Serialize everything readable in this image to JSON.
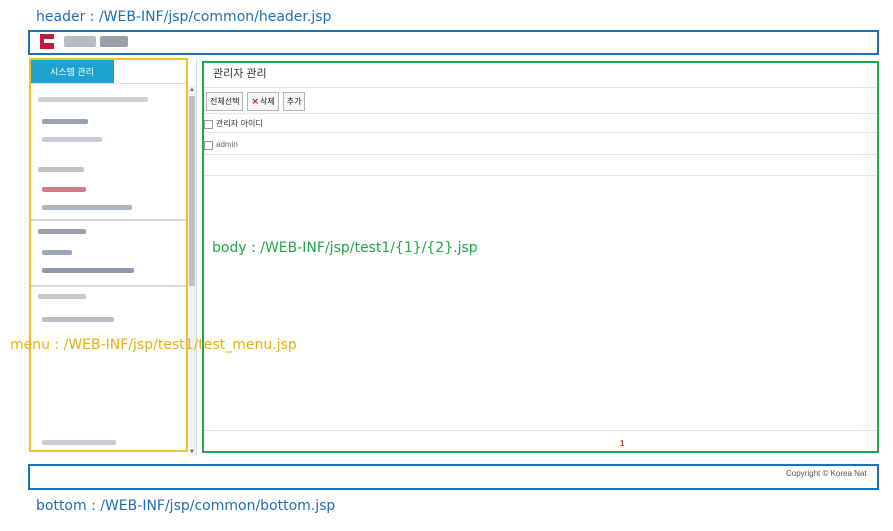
{
  "annotations": {
    "header": "header : /WEB-INF/jsp/common/header.jsp",
    "body": "body : /WEB-INF/jsp/test1/{1}/{2}.jsp",
    "menu": "menu : /WEB-INF/jsp/test1/test_menu.jsp",
    "bottom": "bottom : /WEB-INF/jsp/common/bottom.jsp"
  },
  "colors": {
    "header_frame": "#1f6fb4",
    "body_frame": "#22a64a",
    "menu_frame": "#f2c029",
    "menu_tab": "#1da1cf",
    "logo": "#c4193a",
    "page_number": "#c0441a"
  },
  "menu": {
    "tab_label": "시스템 관리"
  },
  "main": {
    "title": "관리자 관리",
    "toolbar": {
      "select_all_label": "전체선택",
      "delete_icon": "close-icon",
      "delete_label": "삭제",
      "add_label": "추가"
    },
    "table": {
      "header": "관리자 아이디",
      "rows": [
        "admin"
      ]
    },
    "pagination": {
      "current_page": "1"
    }
  },
  "bottom": {
    "copyright": "Copyright © Korea Nat"
  }
}
